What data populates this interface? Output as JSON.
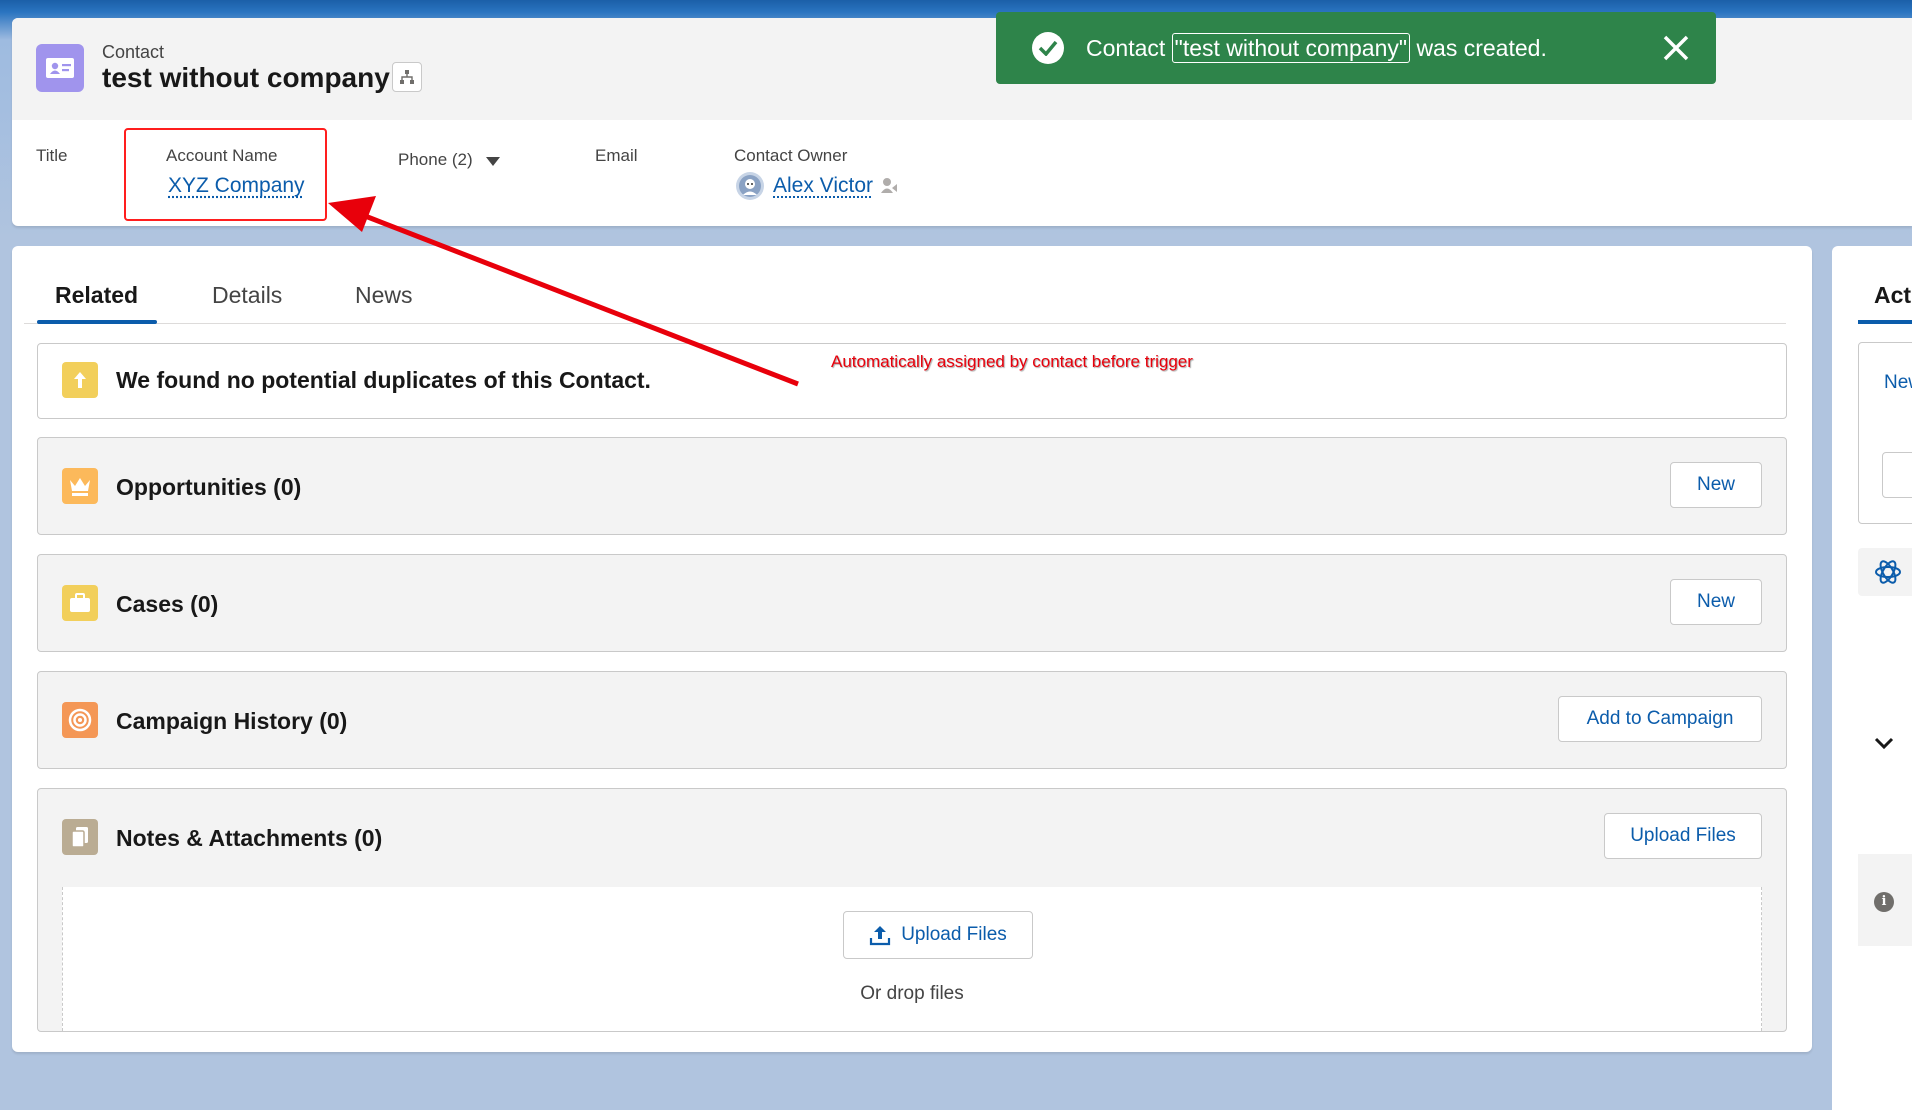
{
  "header": {
    "object_label": "Contact",
    "record_name": "test without company",
    "fields": {
      "title_label": "Title",
      "account_label": "Account Name",
      "account_value": "XYZ Company",
      "phone_label": "Phone (2)",
      "email_label": "Email",
      "owner_label": "Contact Owner",
      "owner_value": "Alex Victor"
    }
  },
  "toast": {
    "prefix": "Contact",
    "record_link": "\"test without company\"",
    "suffix": "was created.",
    "color": "#2e844a"
  },
  "tabs": [
    {
      "label": "Related",
      "active": true
    },
    {
      "label": "Details",
      "active": false
    },
    {
      "label": "News",
      "active": false
    }
  ],
  "annotation": "Automatically assigned by contact before trigger",
  "related": {
    "duplicates": "We found no potential duplicates of this Contact.",
    "opportunities": {
      "title": "Opportunities (0)",
      "button": "New",
      "icon": "crown-icon",
      "color": "#fcb95b"
    },
    "cases": {
      "title": "Cases (0)",
      "button": "New",
      "icon": "briefcase-icon",
      "color": "#f2cf5b"
    },
    "campaign": {
      "title": "Campaign History (0)",
      "button": "Add to Campaign",
      "icon": "target-icon",
      "color": "#f49756"
    },
    "notes": {
      "title": "Notes & Attachments (0)",
      "button": "Upload Files",
      "icon": "files-icon",
      "color": "#baac93",
      "drop_button": "Upload Files",
      "drop_text": "Or drop files"
    }
  },
  "right_panel": {
    "tab": "Activity",
    "new_link": "New"
  },
  "colors": {
    "brand": "#0b5cab",
    "record_icon": "#a094ed"
  }
}
